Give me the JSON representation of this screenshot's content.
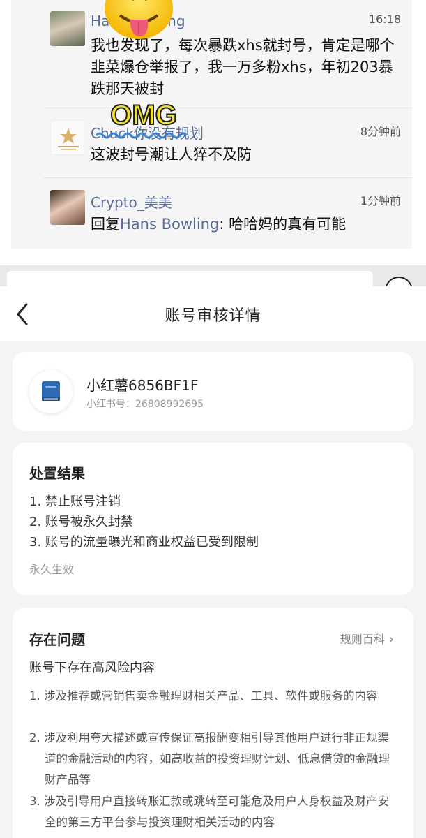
{
  "comments": [
    {
      "author": "Hans Bowling",
      "time": "16:18",
      "text": "我也发现了，每次暴跌xhs就封号，肯定是哪个韭菜爆仓举报了，我一万多粉xhs，年初203暴跌那天被封"
    },
    {
      "author": "Chuck你没有规划",
      "time": "8分钟前",
      "text": "这波封号潮让人猝不及防"
    },
    {
      "author": "Crypto_美美",
      "time": "1分钟前",
      "reply_prefix": "回复",
      "reply_to": "Hans Bowling",
      "reply_text": ": 哈哈妈的真有可能"
    }
  ],
  "sticker_text": "OMG",
  "nav": {
    "back_icon": "chevron-left-icon",
    "title": "账号审核详情"
  },
  "account": {
    "name": "小红薯6856BF1F",
    "id_label": "小红书号：26808992695",
    "icon": "book-icon",
    "icon_color": "#2f6bb3"
  },
  "result": {
    "title": "处置结果",
    "items": [
      "1. 禁止账号注销",
      "2. 账号被永久封禁",
      "3. 账号的流量曝光和商业权益已受到限制"
    ],
    "effect": "永久生效"
  },
  "issues": {
    "title": "存在问题",
    "rules_link": "规则百科",
    "subtitle": "账号下存在高风险内容",
    "items": [
      "1. 涉及推荐或营销售卖金融理财相关产品、工具、软件或服务的内容",
      "2. 涉及利用夸大描述或宣传保证高报酬变相引导其他用户进行非正规渠道的金融活动的内容，如高收益的投资理财计划、低息借贷的金融理财产品等",
      "3. 涉及引导用户直接转账汇款或跳转至可能危及用户人身权益及财产安全的第三方平台参与投资理财相关活动的内容"
    ]
  }
}
